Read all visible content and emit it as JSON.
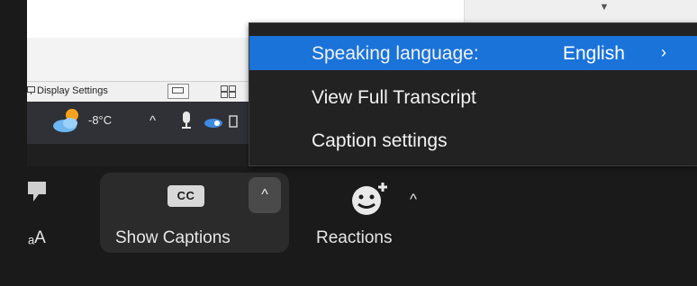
{
  "desktop": {
    "status_bar": {
      "display_settings_label": "Display Settings"
    },
    "taskbar": {
      "temperature": "-8°C"
    }
  },
  "caption_menu": {
    "items": [
      {
        "label": "Speaking language:",
        "value": "English",
        "highlighted": true,
        "has_submenu": true
      },
      {
        "label": "View Full Transcript"
      },
      {
        "label": "Caption settings"
      }
    ],
    "highlight_color": "#1a73d9"
  },
  "toolbar": {
    "partial_left_label": "ₐA",
    "captions": {
      "badge": "CC",
      "label": "Show Captions"
    },
    "reactions": {
      "label": "Reactions"
    }
  },
  "colors": {
    "toolbar_bg": "#1a1a1a",
    "menu_bg": "#222222",
    "captions_group_bg": "#2b2b2b"
  }
}
